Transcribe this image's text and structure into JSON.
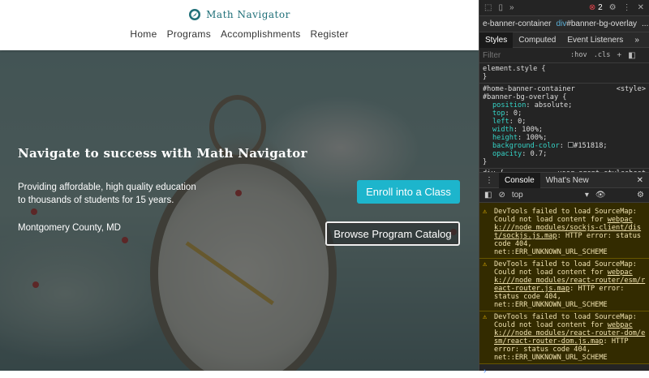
{
  "site": {
    "logo_text": "Math Navigator",
    "nav": [
      "Home",
      "Programs",
      "Accomplishments",
      "Register"
    ],
    "banner": {
      "headline": "Navigate to success with Math Navigator",
      "tagline_1": "Providing affordable, high quality education",
      "tagline_2": "to thousands of students for 15 years.",
      "location": "Montgomery County, MD",
      "enroll_label": "Enroll into a Class",
      "browse_label": "Browse Program Catalog"
    },
    "accent_color": "#1db5cc"
  },
  "devtools": {
    "error_count": "2",
    "breadcrumb": [
      "e-banner-container",
      "div",
      "#banner-bg-overlay",
      "..."
    ],
    "tabs": [
      "Styles",
      "Computed",
      "Event Listeners",
      "»"
    ],
    "filter_placeholder": "Filter",
    "hov": ":hov",
    "cls": ".cls",
    "element_style": "element.style {",
    "close_brace": "}",
    "rule_selector": "#home-banner-container #banner-bg-overlay {",
    "rule_source": "<style>",
    "props": [
      {
        "n": "position",
        "v": "absolute;"
      },
      {
        "n": "top",
        "v": "0;"
      },
      {
        "n": "left",
        "v": "0;"
      },
      {
        "n": "width",
        "v": "100%;"
      },
      {
        "n": "height",
        "v": "100%;"
      },
      {
        "n": "background-color",
        "v": "#151818;"
      },
      {
        "n": "opacity",
        "v": "0.7;"
      }
    ],
    "next_rule": "div {",
    "next_source": "user agent stylesheet",
    "console_tabs": [
      "Console",
      "What's New"
    ],
    "context": "top",
    "messages": [
      {
        "a": "DevTools failed to load SourceMap: Could not load content for ",
        "link": "webpack:///node_modules/sockjs-client/dist/sockjs.js.map",
        "b": ": HTTP error: status code 404, net::ERR_UNKNOWN_URL_SCHEME"
      },
      {
        "a": "DevTools failed to load SourceMap: Could not load content for ",
        "link": "webpack:///node_modules/react-router/esm/react-router.js.map",
        "b": ": HTTP error: status code 404, net::ERR_UNKNOWN_URL_SCHEME"
      },
      {
        "a": "DevTools failed to load SourceMap: Could not load content for ",
        "link": "webpack:///node_modules/react-router-dom/esm/react-router-dom.js.map",
        "b": ": HTTP error: status code 404, net::ERR_UNKNOWN_URL_SCHEME"
      }
    ]
  }
}
